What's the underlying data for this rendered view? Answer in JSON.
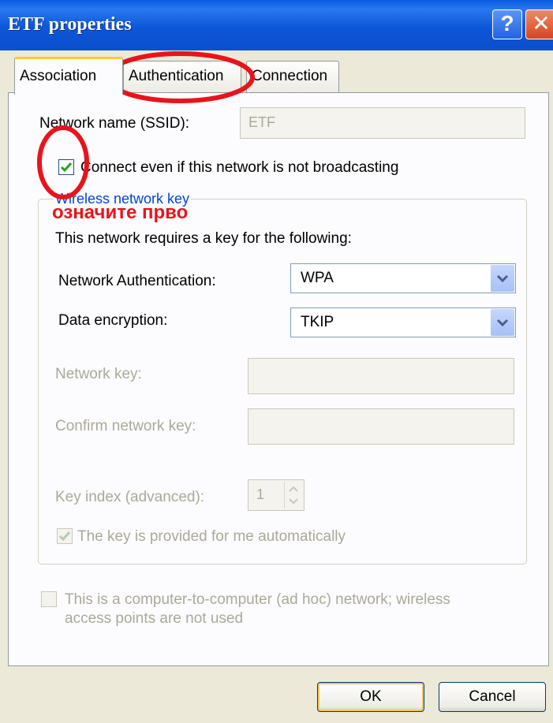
{
  "window": {
    "title": "ETF properties",
    "help_label": "?",
    "close_label": "✕"
  },
  "tabs": [
    {
      "label": "Association",
      "active": true
    },
    {
      "label": "Authentication",
      "active": false
    },
    {
      "label": "Connection",
      "active": false
    }
  ],
  "association": {
    "ssid_label": "Network name (SSID):",
    "ssid_value": "ETF",
    "connect_broadcast_label": "Connect even if this network is not broadcasting",
    "connect_broadcast_checked": true,
    "group_title": "Wireless network key",
    "annotation_text": "означите прво",
    "requires_key_label": "This network requires a key for the following:",
    "network_auth_label": "Network Authentication:",
    "network_auth_value": "WPA",
    "data_encryption_label": "Data encryption:",
    "data_encryption_value": "TKIP",
    "network_key_label": "Network key:",
    "confirm_key_label": "Confirm network key:",
    "key_index_label": "Key index (advanced):",
    "key_index_value": "1",
    "key_auto_label": "The key is provided for me automatically",
    "key_auto_checked": true,
    "adhoc_label_line1": "This is a computer-to-computer (ad hoc) network; wireless",
    "adhoc_label_line2": "access points are not used",
    "adhoc_checked": false
  },
  "buttons": {
    "ok_label": "OK",
    "cancel_label": "Cancel"
  },
  "colors": {
    "titlebar": "#0B4FCC",
    "annotation": "#E8141C",
    "dialog_bg": "#ECE9D8"
  }
}
